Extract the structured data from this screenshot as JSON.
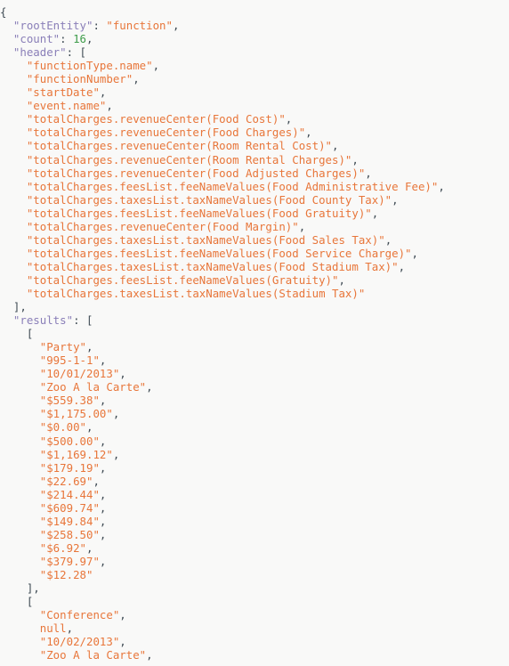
{
  "document": {
    "kind": "json-response",
    "title": "JSON Response Viewer",
    "background_color": "#f9f9f8",
    "colors": {
      "punctuation": "#3f4b54",
      "key": "#8a7fb8",
      "string": "#e8763a",
      "number": "#3e9c4a",
      "null": "#e8763a"
    }
  },
  "json": {
    "rootEntity": "function",
    "count": 16,
    "header": [
      "functionType.name",
      "functionNumber",
      "startDate",
      "event.name",
      "totalCharges.revenueCenter(Food Cost)",
      "totalCharges.revenueCenter(Food Charges)",
      "totalCharges.revenueCenter(Room Rental Cost)",
      "totalCharges.revenueCenter(Room Rental Charges)",
      "totalCharges.revenueCenter(Food Adjusted Charges)",
      "totalCharges.feesList.feeNameValues(Food Administrative Fee)",
      "totalCharges.taxesList.taxNameValues(Food County Tax)",
      "totalCharges.feesList.feeNameValues(Food Gratuity)",
      "totalCharges.revenueCenter(Food Margin)",
      "totalCharges.taxesList.taxNameValues(Food Sales Tax)",
      "totalCharges.feesList.feeNameValues(Food Service Charge)",
      "totalCharges.taxesList.taxNameValues(Food Stadium Tax)",
      "totalCharges.feesList.feeNameValues(Gratuity)",
      "totalCharges.taxesList.taxNameValues(Stadium Tax)"
    ],
    "results": [
      [
        "Party",
        "995-1-1",
        "10/01/2013",
        "Zoo A la Carte",
        "$559.38",
        "$1,175.00",
        "$0.00",
        "$500.00",
        "$1,169.12",
        "$179.19",
        "$22.69",
        "$214.44",
        "$609.74",
        "$149.84",
        "$258.50",
        "$6.92",
        "$379.97",
        "$12.28"
      ],
      [
        "Conference",
        null,
        "10/02/2013",
        "Zoo A la Carte"
      ]
    ]
  },
  "literals": {
    "open_brace": "{",
    "open_bracket": "[",
    "close_bracket_comma": "],",
    "colon_space": ": ",
    "comma": ",",
    "quote": "\"",
    "null_text": "null",
    "key_rootEntity": "rootEntity",
    "key_count": "count",
    "key_header": "header",
    "key_results": "results"
  }
}
